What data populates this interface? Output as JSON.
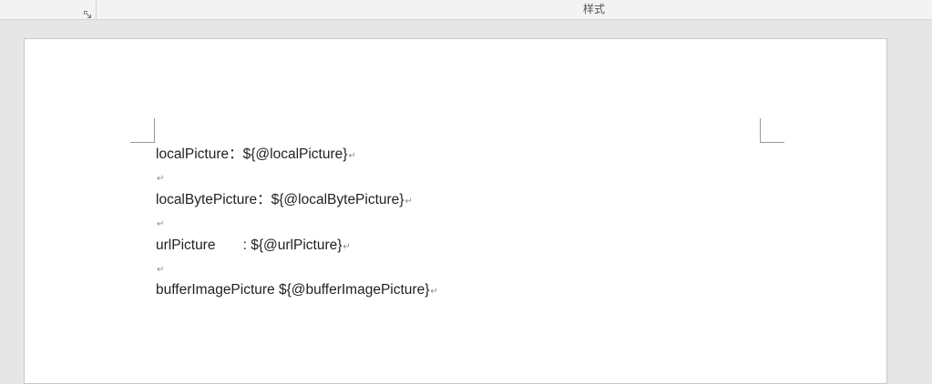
{
  "ribbon": {
    "group_label": "样式",
    "launcher_icon": "dialog-launcher-icon"
  },
  "document": {
    "paragraph_mark": "↵",
    "paragraphs": [
      "localPicture：${@localPicture}",
      "",
      "localBytePicture：${@localBytePicture}",
      "",
      "urlPicture       : ${@urlPicture}",
      "",
      "bufferImagePicture ${@bufferImagePicture}"
    ]
  }
}
